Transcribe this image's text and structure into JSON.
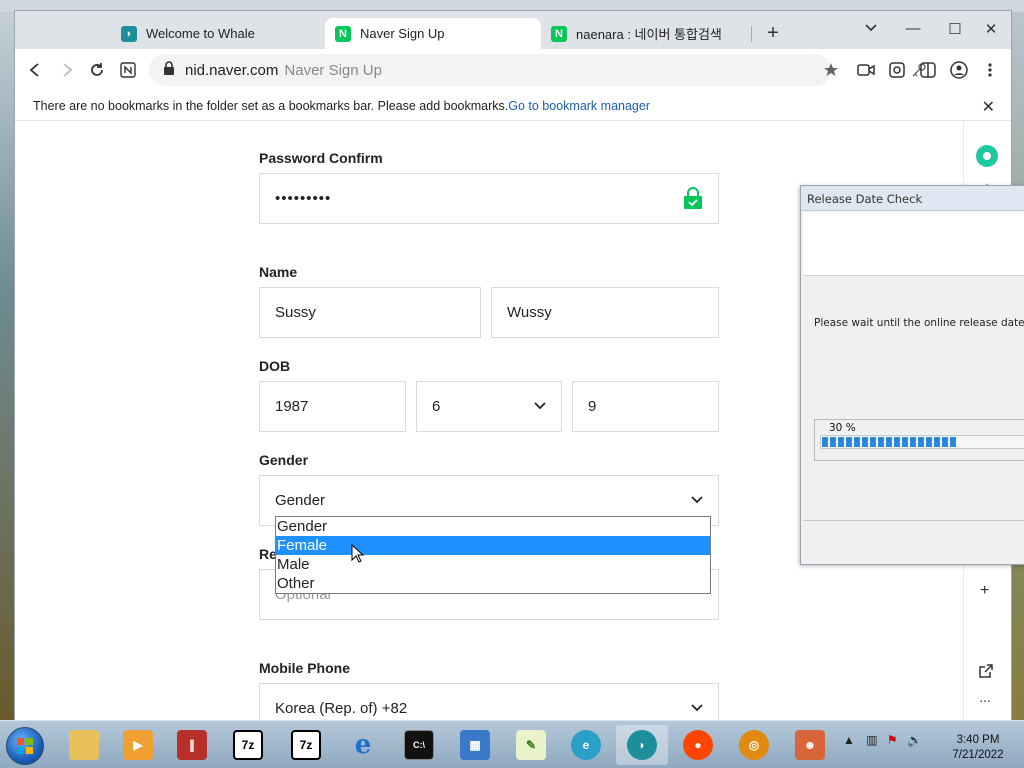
{
  "browser": {
    "tabs": [
      {
        "label": "Welcome to Whale",
        "active": false
      },
      {
        "label": "Naver Sign Up",
        "active": true
      },
      {
        "label": "naenara : 네이버 통합검색",
        "active": false
      }
    ],
    "address": {
      "domain": "nid.naver.com",
      "page_title": "Naver Sign Up"
    },
    "bookmark_bar": {
      "message": "There are no bookmarks in the folder set as a bookmarks bar. Please add bookmarks.",
      "link": "Go to bookmark manager"
    }
  },
  "form": {
    "password_confirm": {
      "label": "Password Confirm",
      "value": "•••••••••"
    },
    "name": {
      "label": "Name",
      "first": "Sussy",
      "last": "Wussy"
    },
    "dob": {
      "label": "DOB",
      "year": "1987",
      "month": "6",
      "day": "9"
    },
    "gender": {
      "label": "Gender",
      "selected": "Gender",
      "options": [
        "Gender",
        "Female",
        "Male",
        "Other"
      ],
      "highlighted_index": 1
    },
    "recovery": {
      "label_visible": "Re",
      "placeholder": "Optional"
    },
    "mobile": {
      "label": "Mobile Phone",
      "country": "Korea (Rep. of) +82"
    }
  },
  "dialog": {
    "title": "Release Date Check",
    "message": "Please wait until the online release date che",
    "progress_text": "30 %",
    "progress_fraction": 0.66
  },
  "taskbar": {
    "apps": [
      "folder-icon",
      "media-player-icon",
      "parallels-icon",
      "7zip-icon",
      "7zip-icon",
      "ie-icon",
      "cmd-icon",
      "network-icon",
      "notepad-icon",
      "edge-icon",
      "whale-icon",
      "reddit-icon",
      "target-icon",
      "game-icon"
    ],
    "clock_time": "3:40 PM",
    "clock_date": "7/21/2022"
  },
  "colors": {
    "naver_green": "#03c75a",
    "highlight": "#1e90ff",
    "progress": "#2c86e0"
  }
}
